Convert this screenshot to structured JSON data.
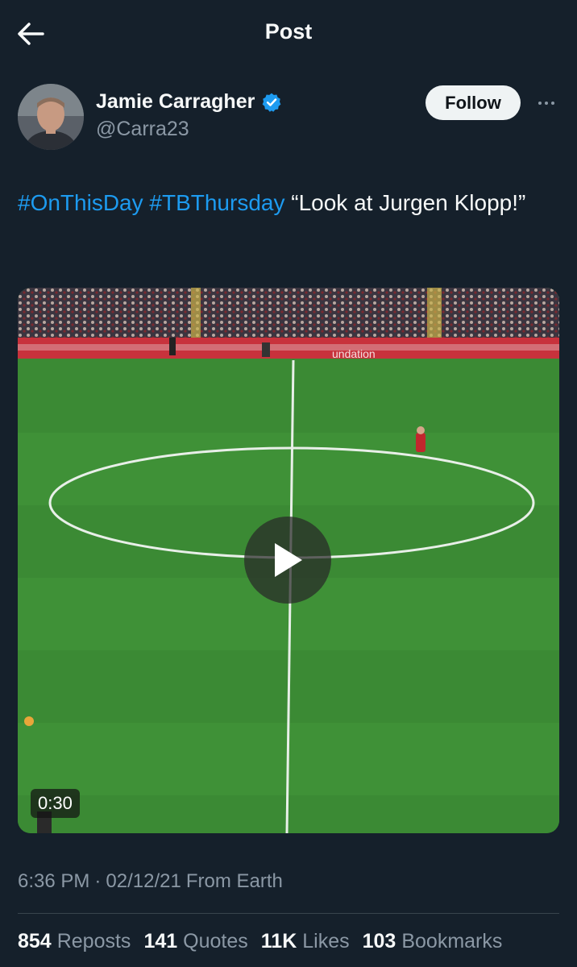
{
  "header": {
    "title": "Post",
    "back_icon": "arrow-left-icon"
  },
  "author": {
    "name": "Jamie Carragher",
    "handle": "@Carra23",
    "verified_icon": "verified-badge-icon",
    "verified_color": "#1d9bf0"
  },
  "follow_label": "Follow",
  "more_icon": "more-horizontal-icon",
  "tweet": {
    "hashtag1": "#OnThisDay",
    "hashtag2": "#TBThursday",
    "text": " “Look at Jurgen Klopp!”"
  },
  "media": {
    "type": "video",
    "duration": "0:30",
    "play_icon": "play-icon",
    "banner_text": "undation"
  },
  "meta": {
    "time": "6:36 PM",
    "separator": "·",
    "date": "02/12/21",
    "source": "From Earth"
  },
  "stats": {
    "reposts_count": "854",
    "reposts_label": "Reposts",
    "quotes_count": "141",
    "quotes_label": "Quotes",
    "likes_count": "11K",
    "likes_label": "Likes",
    "bookmarks_count": "103",
    "bookmarks_label": "Bookmarks"
  },
  "colors": {
    "background": "#15202b",
    "accent": "#1d9bf0",
    "secondary_text": "#8b98a5"
  }
}
